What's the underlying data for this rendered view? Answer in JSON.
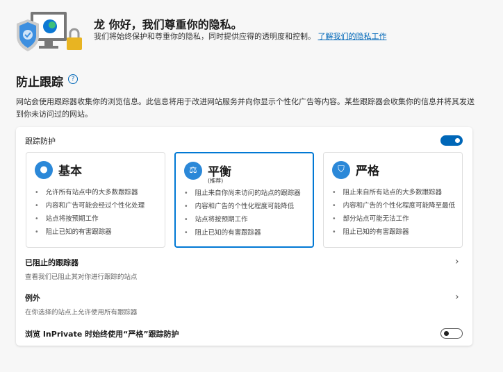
{
  "header": {
    "title": "龙 你好，我们尊重你的隐私。",
    "subtitle": "我们将始终保护和尊重你的隐私，同时提供应得的透明度和控制。",
    "link": "了解我们的隐私工作"
  },
  "section": {
    "title": "防止跟踪",
    "help_icon": "question-circle-icon",
    "description": "网站会使用跟踪器收集你的浏览信息。此信息将用于改进网站服务并向你显示个性化广告等内容。某些跟踪器会收集你的信息并将其发送到你未访问过的网站。"
  },
  "card": {
    "tracking_label": "跟踪防护",
    "tracking_enabled": true,
    "levels": [
      {
        "name": "基本",
        "icon": "cookie-icon",
        "items": [
          "允许所有站点中的大多数跟踪器",
          "内容和广告可能会经过个性化处理",
          "站点将按预期工作",
          "阻止已知的有害跟踪器"
        ]
      },
      {
        "name": "平衡",
        "note": "(推荐)",
        "icon": "scale-icon",
        "selected": true,
        "items": [
          "阻止来自你尚未访问的站点的跟踪器",
          "内容和广告的个性化程度可能降低",
          "站点将按预期工作",
          "阻止已知的有害跟踪器"
        ]
      },
      {
        "name": "严格",
        "icon": "shield-icon",
        "items": [
          "阻止来自所有站点的大多数跟踪器",
          "内容和广告的个性化程度可能降至最低",
          "部分站点可能无法工作",
          "阻止已知的有害跟踪器"
        ]
      }
    ],
    "blocked": {
      "title": "已阻止的跟踪器",
      "subtitle": "查看我们已阻止其对你进行跟踪的站点"
    },
    "exceptions": {
      "title": "例外",
      "subtitle": "在你选择的站点上允许使用所有跟踪器"
    },
    "inprivate": {
      "label": "浏览 InPrivate 时始终使用“严格”跟踪防护",
      "enabled": false
    }
  },
  "colors": {
    "accent": "#0067b8"
  }
}
